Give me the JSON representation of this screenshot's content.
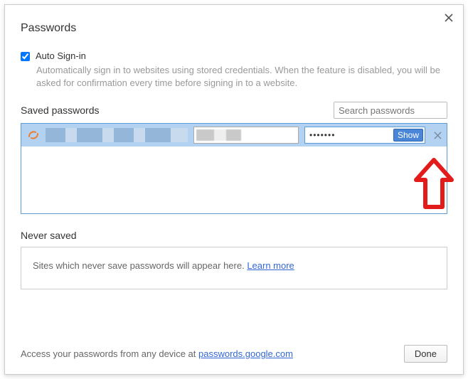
{
  "title": "Passwords",
  "auto_signin": {
    "label": "Auto Sign-in",
    "checked": true,
    "description": "Automatically sign in to websites using stored credentials. When the feature is disabled, you will be asked for confirmation every time before signing in to a website."
  },
  "saved": {
    "title": "Saved passwords",
    "search_placeholder": "Search passwords",
    "row": {
      "password_mask": "•••••••",
      "show_label": "Show"
    }
  },
  "never": {
    "title": "Never saved",
    "text_prefix": "Sites which never save passwords will appear here. ",
    "learn_more": "Learn more"
  },
  "footer": {
    "text_prefix": "Access your passwords from any device at ",
    "link": "passwords.google.com",
    "done": "Done"
  }
}
